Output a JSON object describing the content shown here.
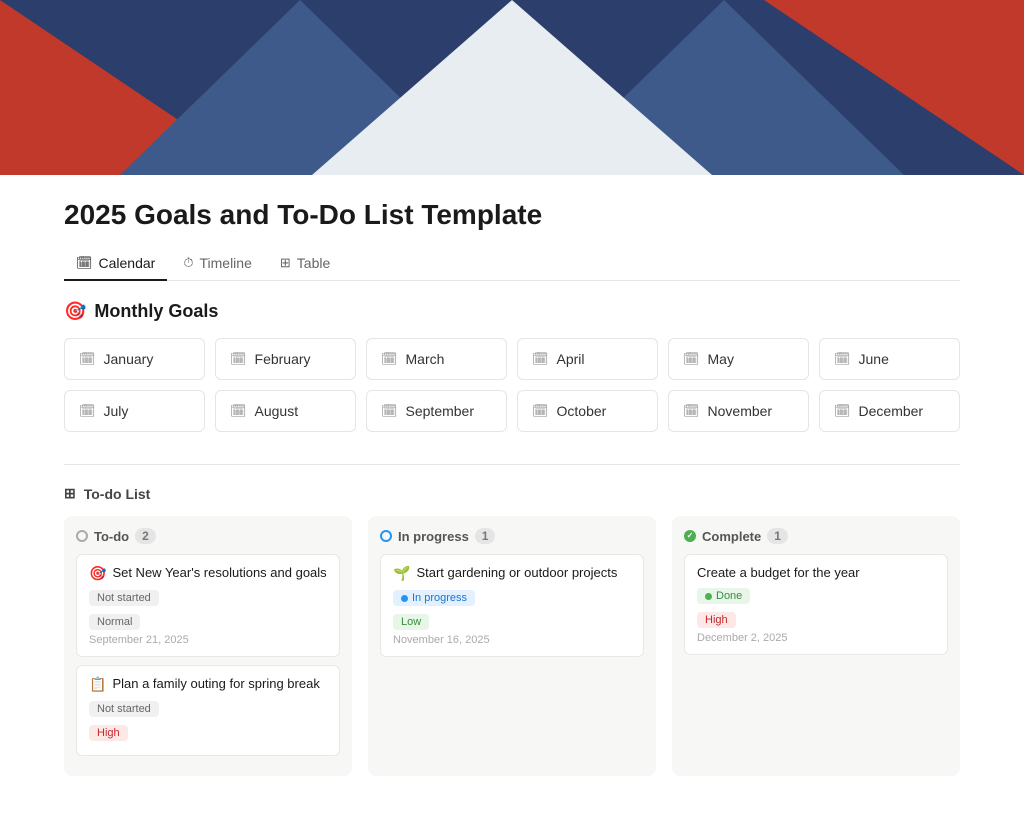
{
  "hero": {
    "alt": "Colorful geometric banner"
  },
  "page": {
    "title": "2025 Goals and To-Do List Template"
  },
  "tabs": [
    {
      "id": "calendar",
      "label": "Calendar",
      "icon": "🗓",
      "active": true
    },
    {
      "id": "timeline",
      "label": "Timeline",
      "icon": "⏱",
      "active": false
    },
    {
      "id": "table",
      "label": "Table",
      "icon": "⊞",
      "active": false
    }
  ],
  "monthly_goals": {
    "title": "Monthly Goals",
    "emoji": "🎯",
    "months": [
      {
        "label": "January",
        "icon": "🗓"
      },
      {
        "label": "February",
        "icon": "🗓"
      },
      {
        "label": "March",
        "icon": "🗓"
      },
      {
        "label": "April",
        "icon": "🗓"
      },
      {
        "label": "May",
        "icon": "🗓"
      },
      {
        "label": "June",
        "icon": "🗓"
      },
      {
        "label": "July",
        "icon": "🗓"
      },
      {
        "label": "August",
        "icon": "🗓"
      },
      {
        "label": "September",
        "icon": "🗓"
      },
      {
        "label": "October",
        "icon": "🗓"
      },
      {
        "label": "November",
        "icon": "🗓"
      },
      {
        "label": "December",
        "icon": "🗓"
      }
    ]
  },
  "todo_list": {
    "title": "To-do List",
    "icon": "⊞",
    "columns": [
      {
        "id": "todo",
        "label": "To-do",
        "count": 2,
        "status_type": "outline",
        "cards": [
          {
            "title": "Set New Year's resolutions and goals",
            "emoji": "🎯",
            "status_badge": "Not started",
            "status_badge_type": "gray",
            "priority": "Normal",
            "priority_type": "normal",
            "date": "September 21, 2025"
          },
          {
            "title": "Plan a family outing for spring break",
            "emoji": "📋",
            "status_badge": "Not started",
            "status_badge_type": "gray",
            "priority": "High",
            "priority_type": "high",
            "date": null
          }
        ]
      },
      {
        "id": "in_progress",
        "label": "In progress",
        "count": 1,
        "status_type": "progress",
        "cards": [
          {
            "title": "Start gardening or outdoor projects",
            "emoji": "🌱",
            "status_badge": "In progress",
            "status_badge_type": "blue",
            "priority": "Low",
            "priority_type": "low",
            "date": "November 16, 2025"
          }
        ]
      },
      {
        "id": "complete",
        "label": "Complete",
        "count": 1,
        "status_type": "complete",
        "cards": [
          {
            "title": "Create a budget for the year",
            "emoji": null,
            "status_badge": "Done",
            "status_badge_type": "green",
            "priority": "High",
            "priority_type": "high",
            "date": "December 2, 2025"
          }
        ]
      }
    ]
  }
}
